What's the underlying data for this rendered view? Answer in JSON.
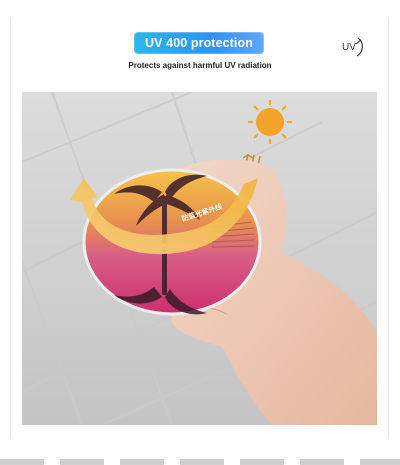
{
  "header": {
    "badge_text": "UV 400 protection",
    "subtitle": "Protects against harmful UV radiation",
    "logo_text": "UV"
  },
  "image": {
    "lens_label": "防蓝光紫外线"
  },
  "colors": {
    "badge_start": "#29b7e8",
    "badge_end": "#5fa8ff",
    "sun": "#f4a32a",
    "arrow": "#f6c35a",
    "lens_top": "#f0b23b",
    "lens_bottom": "#d4447a"
  },
  "icons": [
    "uv-logo-icon",
    "sun-icon",
    "uv-rays-icon",
    "arrow-icon"
  ]
}
